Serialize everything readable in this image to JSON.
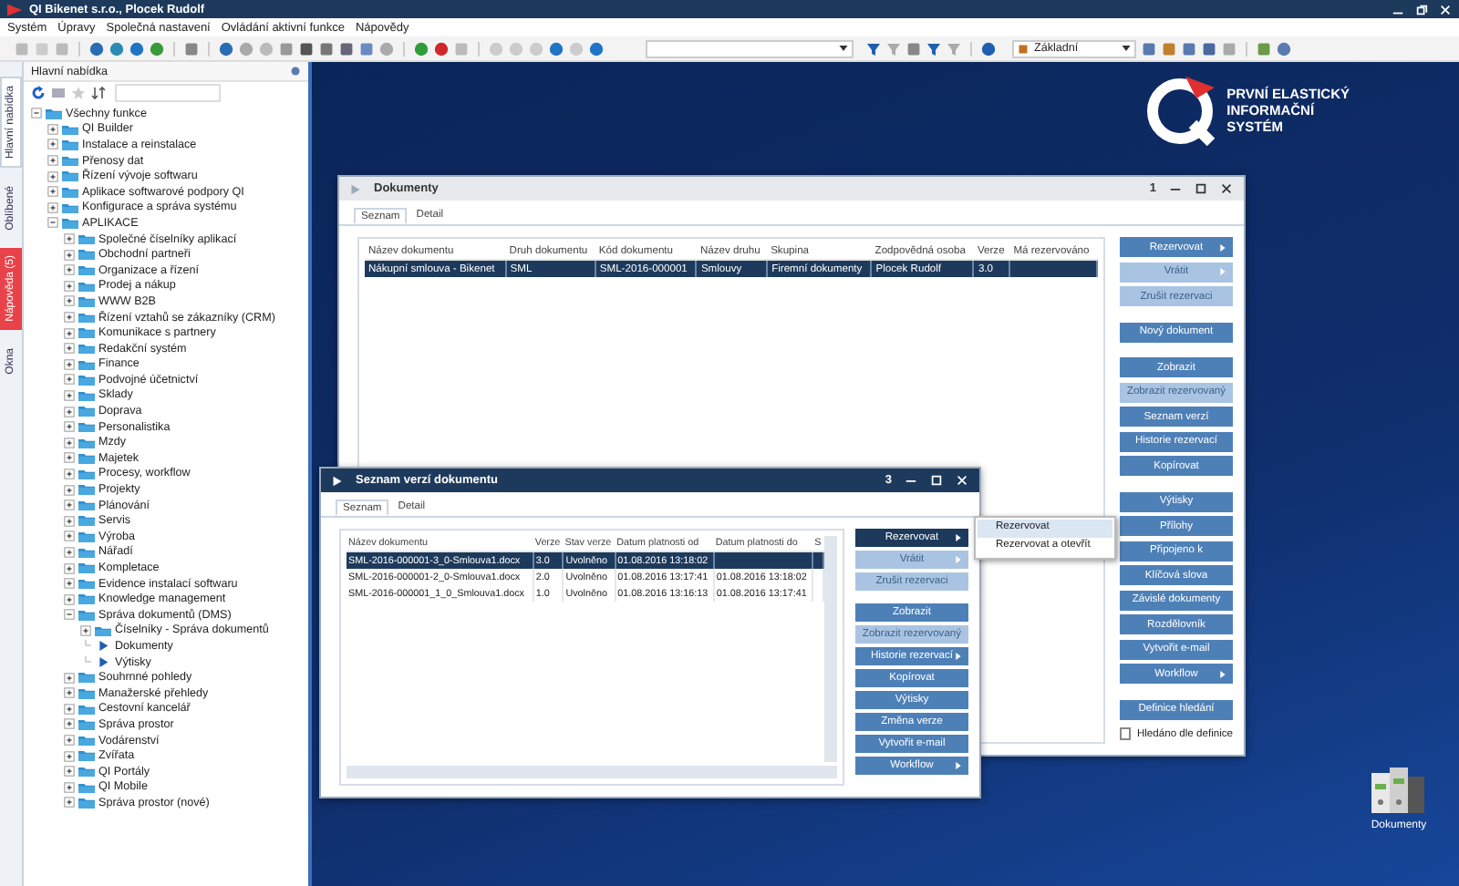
{
  "window": {
    "title": "QI Bikenet s.r.o., Plocek Rudolf"
  },
  "menu": [
    "Systém",
    "Úpravy",
    "Společná nastavení",
    "Ovládání aktivní funkce",
    "Nápovědy"
  ],
  "toolbar": {
    "profile": "Základní"
  },
  "side_tabs": [
    {
      "label": "Hlavní nabídka",
      "selected": true,
      "alert": false
    },
    {
      "label": "Oblíbené",
      "selected": false,
      "alert": false
    },
    {
      "label": "Nápověda (5)",
      "selected": false,
      "alert": true
    },
    {
      "label": "Okna",
      "selected": false,
      "alert": false
    }
  ],
  "navigator": {
    "title": "Hlavní nabídka",
    "tree": [
      {
        "label": "Všechny funkce",
        "kind": "folder",
        "expanded": true,
        "children": [
          {
            "label": "QI Builder",
            "kind": "folder",
            "expanded": false
          },
          {
            "label": "Instalace a reinstalace",
            "kind": "folder",
            "expanded": false
          },
          {
            "label": "Přenosy dat",
            "kind": "folder",
            "expanded": false
          },
          {
            "label": "Řízení vývoje softwaru",
            "kind": "folder",
            "expanded": false
          },
          {
            "label": "Aplikace softwarové podpory QI",
            "kind": "folder",
            "expanded": false
          },
          {
            "label": "Konfigurace a správa systému",
            "kind": "folder",
            "expanded": false
          },
          {
            "label": "APLIKACE",
            "kind": "folder",
            "expanded": true,
            "children": [
              {
                "label": "Společné číselníky aplikací",
                "kind": "folder",
                "expanded": false
              },
              {
                "label": "Obchodní partneři",
                "kind": "folder",
                "expanded": false
              },
              {
                "label": "Organizace a řízení",
                "kind": "folder",
                "expanded": false
              },
              {
                "label": "Prodej a nákup",
                "kind": "folder",
                "expanded": false
              },
              {
                "label": "WWW B2B",
                "kind": "folder",
                "expanded": false
              },
              {
                "label": "Řízení vztahů se zákazníky (CRM)",
                "kind": "folder",
                "expanded": false
              },
              {
                "label": "Komunikace s partnery",
                "kind": "folder",
                "expanded": false
              },
              {
                "label": "Redakční systém",
                "kind": "folder",
                "expanded": false
              },
              {
                "label": "Finance",
                "kind": "folder",
                "expanded": false
              },
              {
                "label": "Podvojné účetnictví",
                "kind": "folder",
                "expanded": false
              },
              {
                "label": "Sklady",
                "kind": "folder",
                "expanded": false
              },
              {
                "label": "Doprava",
                "kind": "folder",
                "expanded": false
              },
              {
                "label": "Personalistika",
                "kind": "folder",
                "expanded": false
              },
              {
                "label": "Mzdy",
                "kind": "folder",
                "expanded": false
              },
              {
                "label": "Majetek",
                "kind": "folder",
                "expanded": false
              },
              {
                "label": "Procesy, workflow",
                "kind": "folder",
                "expanded": false
              },
              {
                "label": "Projekty",
                "kind": "folder",
                "expanded": false
              },
              {
                "label": "Plánování",
                "kind": "folder",
                "expanded": false
              },
              {
                "label": "Servis",
                "kind": "folder",
                "expanded": false
              },
              {
                "label": "Výroba",
                "kind": "folder",
                "expanded": false
              },
              {
                "label": "Nářadí",
                "kind": "folder",
                "expanded": false
              },
              {
                "label": "Kompletace",
                "kind": "folder",
                "expanded": false
              },
              {
                "label": "Evidence instalací softwaru",
                "kind": "folder",
                "expanded": false
              },
              {
                "label": "Knowledge management",
                "kind": "folder",
                "expanded": false
              },
              {
                "label": "Správa dokumentů (DMS)",
                "kind": "folder",
                "expanded": true,
                "children": [
                  {
                    "label": "Číselníky - Správa dokumentů",
                    "kind": "folder",
                    "expanded": false
                  },
                  {
                    "label": "Dokumenty",
                    "kind": "function"
                  },
                  {
                    "label": "Výtisky",
                    "kind": "function"
                  }
                ]
              },
              {
                "label": "Souhrnné pohledy",
                "kind": "folder",
                "expanded": false
              },
              {
                "label": "Manažerské přehledy",
                "kind": "folder",
                "expanded": false
              },
              {
                "label": "Cestovní kancelář",
                "kind": "folder",
                "expanded": false
              },
              {
                "label": "Správa prostor",
                "kind": "folder",
                "expanded": false
              },
              {
                "label": "Vodárenství",
                "kind": "folder",
                "expanded": false
              },
              {
                "label": "Zvířata",
                "kind": "folder",
                "expanded": false
              },
              {
                "label": "QI Portály",
                "kind": "folder",
                "expanded": false
              },
              {
                "label": "QI Mobile",
                "kind": "folder",
                "expanded": false
              },
              {
                "label": "Správa prostor (nové)",
                "kind": "folder",
                "expanded": false
              }
            ]
          }
        ]
      }
    ]
  },
  "logo": {
    "lines": [
      "PRVNÍ ELASTICKÝ",
      "INFORMAČNÍ",
      "SYSTÉM"
    ]
  },
  "desktop_icons": [
    {
      "label": "Dokumenty"
    }
  ],
  "windows": [
    {
      "title": "Dokumenty",
      "number": "1",
      "active": false,
      "tabs": [
        {
          "label": "Seznam",
          "selected": true
        },
        {
          "label": "Detail",
          "selected": false
        }
      ],
      "columns": [
        "Název dokumentu",
        "Druh dokumentu",
        "Kód dokumentu",
        "Název druhu",
        "Skupina",
        "Zodpovědná osoba",
        "Verze",
        "Má rezervováno"
      ],
      "rows": [
        {
          "cells": [
            "Nákupní smlouva - Bikenet",
            "SML",
            "SML-2016-000001",
            "Smlouvy",
            "Firemní dokumenty",
            "Plocek Rudolf",
            "3.0",
            ""
          ],
          "selected": true
        }
      ],
      "buttons": [
        {
          "label": "Rezervovat",
          "disabled": false,
          "submenu": true,
          "separator_before": false,
          "highlighted": false
        },
        {
          "label": "Vrátit",
          "disabled": true,
          "submenu": true,
          "separator_before": false,
          "highlighted": false
        },
        {
          "label": "Zrušit rezervaci",
          "disabled": true,
          "submenu": false,
          "separator_before": false,
          "highlighted": false
        },
        {
          "label": "Nový dokument",
          "disabled": false,
          "submenu": false,
          "separator_before": true,
          "highlighted": false
        },
        {
          "label": "Zobrazit",
          "disabled": false,
          "submenu": false,
          "separator_before": true,
          "highlighted": false
        },
        {
          "label": "Zobrazit rezervovaný",
          "disabled": true,
          "submenu": false,
          "separator_before": false,
          "highlighted": false
        },
        {
          "label": "Seznam verzí",
          "disabled": false,
          "submenu": false,
          "separator_before": false,
          "highlighted": false
        },
        {
          "label": "Historie rezervací",
          "disabled": false,
          "submenu": false,
          "separator_before": false,
          "highlighted": false
        },
        {
          "label": "Kopírovat",
          "disabled": false,
          "submenu": false,
          "separator_before": false,
          "highlighted": false
        },
        {
          "label": "Výtisky",
          "disabled": false,
          "submenu": false,
          "separator_before": true,
          "highlighted": false
        },
        {
          "label": "Přílohy",
          "disabled": false,
          "submenu": false,
          "separator_before": false,
          "highlighted": false
        },
        {
          "label": "Připojeno k",
          "disabled": false,
          "submenu": false,
          "separator_before": false,
          "highlighted": false
        },
        {
          "label": "Klíčová slova",
          "disabled": false,
          "submenu": false,
          "separator_before": false,
          "highlighted": false
        },
        {
          "label": "Závislé dokumenty",
          "disabled": false,
          "submenu": false,
          "separator_before": false,
          "highlighted": false
        },
        {
          "label": "Rozdělovník",
          "disabled": false,
          "submenu": false,
          "separator_before": false,
          "highlighted": false
        },
        {
          "label": "Vytvořit e-mail",
          "disabled": false,
          "submenu": false,
          "separator_before": false,
          "highlighted": false
        },
        {
          "label": "Workflow",
          "disabled": false,
          "submenu": true,
          "separator_before": false,
          "highlighted": false
        },
        {
          "label": "Definice hledání",
          "disabled": false,
          "submenu": false,
          "separator_before": true,
          "highlighted": false
        }
      ],
      "checkbox": {
        "label": "Hledáno dle definice",
        "checked": false
      }
    },
    {
      "title": "Seznam verzí dokumentu",
      "number": "3",
      "active": true,
      "tabs": [
        {
          "label": "Seznam",
          "selected": true
        },
        {
          "label": "Detail",
          "selected": false
        }
      ],
      "columns": [
        "Název dokumentu",
        "Verze",
        "Stav verze",
        "Datum platnosti od",
        "Datum platnosti do",
        "S"
      ],
      "rows": [
        {
          "cells": [
            "SML-2016-000001-3_0-Smlouva1.docx",
            "3.0",
            "Uvolněno",
            "01.08.2016 13:18:02",
            "",
            ""
          ],
          "selected": true
        },
        {
          "cells": [
            "SML-2016-000001-2_0-Smlouva1.docx",
            "2.0",
            "Uvolněno",
            "01.08.2016 13:17:41",
            "01.08.2016 13:18:02",
            ""
          ],
          "selected": false
        },
        {
          "cells": [
            "SML-2016-000001_1_0_Smlouva1.docx",
            "1.0",
            "Uvolněno",
            "01.08.2016 13:16:13",
            "01.08.2016 13:17:41",
            ""
          ],
          "selected": false
        }
      ],
      "buttons": [
        {
          "label": "Rezervovat",
          "disabled": false,
          "submenu": true,
          "separator_before": false,
          "highlighted": true
        },
        {
          "label": "Vrátit",
          "disabled": true,
          "submenu": true,
          "separator_before": false,
          "highlighted": false
        },
        {
          "label": "Zrušit rezervaci",
          "disabled": true,
          "submenu": false,
          "separator_before": false,
          "highlighted": false
        },
        {
          "label": "Zobrazit",
          "disabled": false,
          "submenu": false,
          "separator_before": true,
          "highlighted": false
        },
        {
          "label": "Zobrazit rezervovaný",
          "disabled": true,
          "submenu": false,
          "separator_before": false,
          "highlighted": false
        },
        {
          "label": "Historie rezervací",
          "disabled": false,
          "submenu": true,
          "separator_before": false,
          "highlighted": false
        },
        {
          "label": "Kopírovat",
          "disabled": false,
          "submenu": false,
          "separator_before": false,
          "highlighted": false
        },
        {
          "label": "Výtisky",
          "disabled": false,
          "submenu": false,
          "separator_before": false,
          "highlighted": false
        },
        {
          "label": "Změna verze",
          "disabled": false,
          "submenu": false,
          "separator_before": false,
          "highlighted": false
        },
        {
          "label": "Vytvořit e-mail",
          "disabled": false,
          "submenu": false,
          "separator_before": false,
          "highlighted": false
        },
        {
          "label": "Workflow",
          "disabled": false,
          "submenu": true,
          "separator_before": false,
          "highlighted": false
        }
      ],
      "popup": [
        {
          "label": "Rezervovat",
          "selected": true
        },
        {
          "label": "Rezervovat a otevřít",
          "selected": false
        }
      ]
    }
  ]
}
